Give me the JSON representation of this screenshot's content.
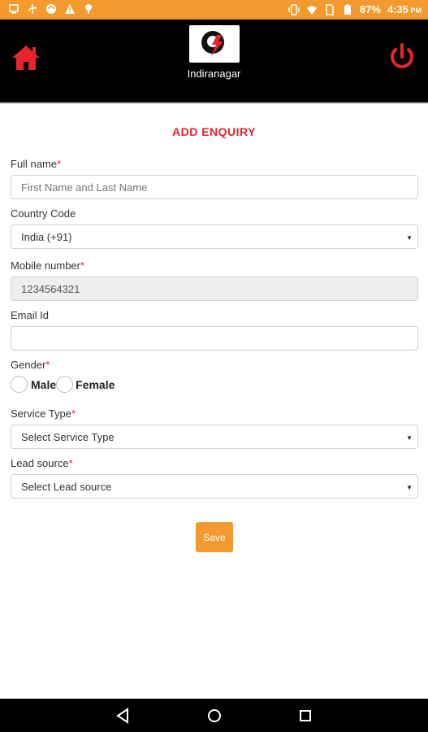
{
  "status_bar": {
    "battery_percent": "87%",
    "time": "4:35",
    "icons": [
      "screen-icon",
      "usb-icon",
      "sync-icon",
      "warning-icon",
      "location-icon",
      "vibrate-icon",
      "wifi-icon",
      "sim-icon",
      "battery-icon"
    ]
  },
  "header": {
    "branch_name": "Indiranagar",
    "home_icon_color": "#e8232a",
    "power_icon_color": "#e8232a"
  },
  "form": {
    "title": "ADD ENQUIRY",
    "required_mark": "*",
    "full_name": {
      "label": "Full name",
      "placeholder": "First Name and Last Name",
      "value": ""
    },
    "country_code": {
      "label": "Country Code",
      "selected": "India (+91)"
    },
    "mobile": {
      "label": "Mobile number",
      "value": "1234564321"
    },
    "email": {
      "label": "Email Id",
      "value": ""
    },
    "gender": {
      "label": "Gender",
      "options": [
        "Male",
        "Female"
      ]
    },
    "service_type": {
      "label": "Service Type",
      "selected": "Select Service Type"
    },
    "lead_source": {
      "label": "Lead source",
      "selected": "Select Lead source"
    },
    "save_label": "Save"
  },
  "colors": {
    "accent_orange": "#f29a2e",
    "accent_red": "#e8232a",
    "header_bg": "#000000"
  }
}
